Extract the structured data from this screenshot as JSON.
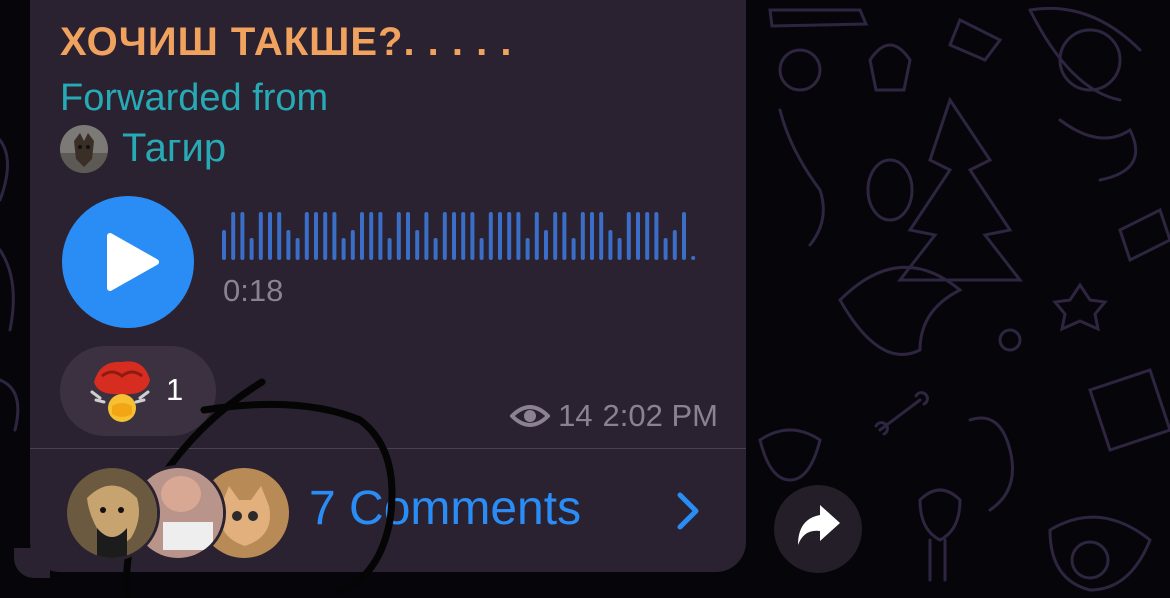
{
  "message": {
    "title": "ХОЧИШ ТАКШЕ?. . . . .",
    "forwarded_label": "Forwarded from",
    "sender_name": "Тагир",
    "voice_duration": "0:18",
    "reaction": {
      "icon": "mind-blown-emoji-icon",
      "count": "1"
    },
    "views": "14",
    "time": "2:02 PM",
    "comments_label": "7 Comments"
  },
  "colors": {
    "title": "#f0a25e",
    "forward": "#27aab5",
    "accent": "#2a8df6",
    "bubble": "#2a2230",
    "background": "#060509"
  }
}
